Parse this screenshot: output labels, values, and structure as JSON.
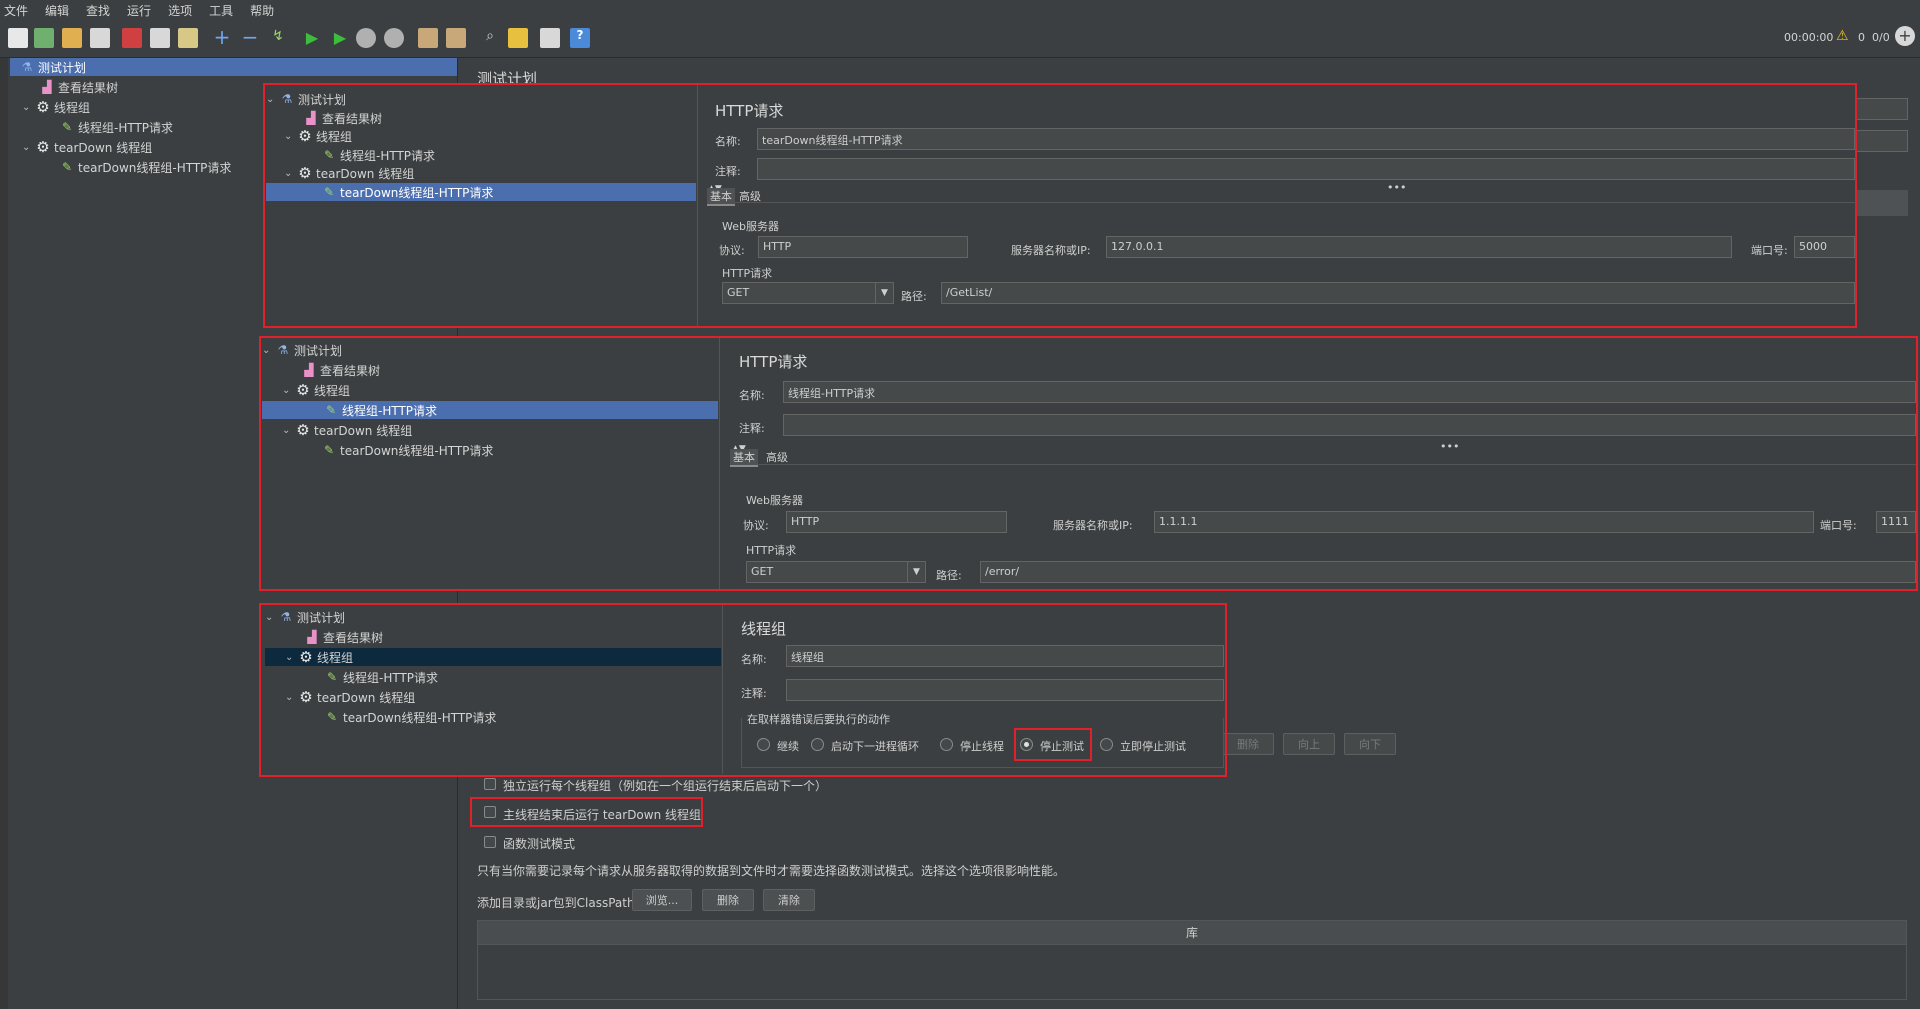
{
  "menu": [
    "文件",
    "编辑",
    "查找",
    "运行",
    "选项",
    "工具",
    "帮助"
  ],
  "status": {
    "time": "00:00:00",
    "warnings": "0",
    "threads": "0/0"
  },
  "sidebar": {
    "items": [
      {
        "label": "测试计划",
        "icon": "flask-icon"
      },
      {
        "label": "查看结果树",
        "icon": "graph-icon"
      },
      {
        "label": "线程组",
        "icon": "gear-icon"
      },
      {
        "label": "线程组-HTTP请求",
        "icon": "pencil-icon"
      },
      {
        "label": "tearDown 线程组",
        "icon": "gear-icon"
      },
      {
        "label": "tearDown线程组-HTTP请求",
        "icon": "pencil-icon"
      }
    ]
  },
  "main": {
    "title": "测试计划",
    "opt_independent": "独立运行每个线程组（例如在一个组运行结束后启动下一个）",
    "opt_teardown": "主线程结束后运行 tearDown 线程组",
    "opt_functional": "函数测试模式",
    "functional_note": "只有当你需要记录每个请求从服务器取得的数据到文件时才需要选择函数测试模式。选择这个选项很影响性能。",
    "classpath_label": "添加目录或jar包到ClassPath",
    "browse": "浏览...",
    "delete": "删除",
    "clear": "清除",
    "lib_header": "库",
    "var_buttons": [
      "删除",
      "向上",
      "向下"
    ]
  },
  "overlay1": {
    "tree": [
      "测试计划",
      "查看结果树",
      "线程组",
      "线程组-HTTP请求",
      "tearDown 线程组",
      "tearDown线程组-HTTP请求"
    ],
    "title": "HTTP请求",
    "name_label": "名称:",
    "name": "tearDown线程组-HTTP请求",
    "comment_label": "注释:",
    "tabs": [
      "基本",
      "高级"
    ],
    "web_server": "Web服务器",
    "protocol_label": "协议:",
    "protocol": "HTTP",
    "server_label": "服务器名称或IP:",
    "server": "127.0.0.1",
    "port_label": "端口号:",
    "port": "5000",
    "http_request": "HTTP请求",
    "method": "GET",
    "path_label": "路径:",
    "path": "/GetList/"
  },
  "overlay2": {
    "tree": [
      "测试计划",
      "查看结果树",
      "线程组",
      "线程组-HTTP请求",
      "tearDown 线程组",
      "tearDown线程组-HTTP请求"
    ],
    "title": "HTTP请求",
    "name_label": "名称:",
    "name": "线程组-HTTP请求",
    "comment_label": "注释:",
    "tabs": [
      "基本",
      "高级"
    ],
    "web_server": "Web服务器",
    "protocol_label": "协议:",
    "protocol": "HTTP",
    "server_label": "服务器名称或IP:",
    "server": "1.1.1.1",
    "port_label": "端口号:",
    "port": "1111",
    "http_request": "HTTP请求",
    "method": "GET",
    "path_label": "路径:",
    "path": "/error/"
  },
  "overlay3": {
    "tree": [
      "测试计划",
      "查看结果树",
      "线程组",
      "线程组-HTTP请求",
      "tearDown 线程组",
      "tearDown线程组-HTTP请求"
    ],
    "title": "线程组",
    "name_label": "名称:",
    "name": "线程组",
    "comment_label": "注释:",
    "action_label": "在取样器错误后要执行的动作",
    "actions": [
      "继续",
      "启动下一进程循环",
      "停止线程",
      "停止测试",
      "立即停止测试"
    ],
    "selected_action": 3
  }
}
